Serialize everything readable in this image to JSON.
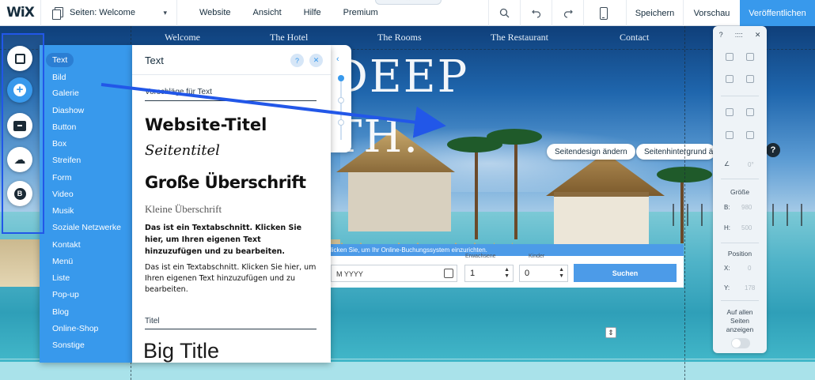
{
  "topbar": {
    "logo": "WiX",
    "page_selector": "Seiten: Welcome",
    "menu": [
      "Website",
      "Ansicht",
      "Hilfe",
      "Premium"
    ],
    "tools": [
      "zoom-icon",
      "undo-icon",
      "redo-icon",
      "mobile-view-icon"
    ],
    "save": "Speichern",
    "preview": "Vorschau",
    "publish": "Veröffentlichen",
    "publish_color": "#3899ec"
  },
  "site": {
    "nav": [
      "Welcome",
      "The Hotel",
      "The Rooms",
      "The Restaurant",
      "Contact"
    ],
    "hero_line1": "DEEP",
    "hero_line2": "TH.",
    "booking_banner": "licken Sie, um Ihr Online-Buchungssystem einzurichten.",
    "label_adults": "Erwachsene",
    "label_kids": "Kinder",
    "date_value": "M YYYY",
    "adults_value": "1",
    "kids_value": "0",
    "search_button": "Suchen",
    "pill_design": "Seitendesign ändern",
    "pill_background": "Seitenhintergrund ä"
  },
  "rail": {
    "items": [
      "background-icon",
      "add-icon",
      "app-market-icon",
      "upload-icon",
      "blog-icon"
    ]
  },
  "add_panel": {
    "categories": [
      "Text",
      "Bild",
      "Galerie",
      "Diashow",
      "Button",
      "Box",
      "Streifen",
      "Form",
      "Video",
      "Musik",
      "Soziale Netzwerke",
      "Kontakt",
      "Menü",
      "Liste",
      "Pop-up",
      "Blog",
      "Online-Shop",
      "Sonstige"
    ],
    "selected": "Text",
    "panel_color": "#3899ec"
  },
  "text_panel": {
    "title": "Text",
    "help": "?",
    "close": "✕",
    "section_suggestions": "Vorschläge für Text",
    "preset_h1": "Website-Titel",
    "preset_h2": "Seitentitel",
    "preset_h3": "Große Überschrift",
    "preset_h4": "Kleine Überschrift",
    "preset_p1": "Das ist ein Textabschnitt. Klicken Sie hier, um Ihren eigenen Text hinzuzufügen und zu bearbeiten.",
    "preset_p2": "Das ist ein Textabschnitt. Klicken Sie hier, um Ihren eigenen Text hinzuzufügen und zu bearbeiten.",
    "section_titles": "Titel",
    "big_title": "Big Title"
  },
  "prop_panel": {
    "help": "?",
    "drag": "::::",
    "close": "✕",
    "rotation": "0°",
    "size_label": "Größe",
    "w_label": "B:",
    "w_value": "980",
    "h_label": "H:",
    "h_value": "500",
    "position_label": "Position",
    "x_label": "X:",
    "x_value": "0",
    "y_label": "Y:",
    "y_value": "178",
    "show_all_pages": "Auf allen Seiten anzeigen"
  },
  "annotation": {
    "arrow_color": "#2257e8"
  }
}
